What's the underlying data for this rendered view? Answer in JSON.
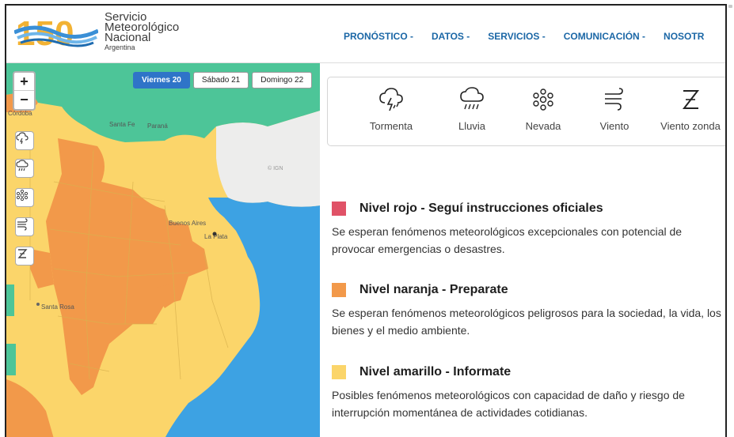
{
  "brand": {
    "logo_number": "150",
    "line1": "Servicio",
    "line2": "Meteorológico",
    "line3": "Nacional",
    "line4": "Argentina"
  },
  "nav": {
    "items": [
      "PRONÓSTICO -",
      "DATOS -",
      "SERVICIOS -",
      "COMUNICACIÓN -",
      "NOSOTR"
    ]
  },
  "map": {
    "zoom_in": "+",
    "zoom_out": "−",
    "days": [
      "Viernes 20",
      "Sábado 21",
      "Domingo 22"
    ],
    "active_day": "Viernes 20",
    "place_labels": [
      "Córdoba",
      "Santa Fe",
      "Paraná",
      "Buenos Aires",
      "La Plata",
      "Santa Rosa"
    ],
    "attribution": "© IGN"
  },
  "phenomena": [
    {
      "label": "Tormenta",
      "icon": "storm-icon"
    },
    {
      "label": "Lluvia",
      "icon": "rain-icon"
    },
    {
      "label": "Nevada",
      "icon": "snow-icon"
    },
    {
      "label": "Viento",
      "icon": "wind-icon"
    },
    {
      "label": "Viento zonda",
      "icon": "zonda-icon"
    }
  ],
  "levels": [
    {
      "title": "Nivel rojo - Seguí instrucciones oficiales",
      "color": "#e05267",
      "description": "Se esperan fenómenos meteorológicos excepcionales con potencial de provocar emergencias o desastres."
    },
    {
      "title": "Nivel naranja - Preparate",
      "color": "#f2994a",
      "description": "Se esperan fenómenos meteorológicos peligrosos para la sociedad, la vida, los bienes y el medio ambiente."
    },
    {
      "title": "Nivel amarillo - Informate",
      "color": "#fbd56a",
      "description": "Posibles fenómenos meteorológicos con capacidad de daño y riesgo de interrupción momentánea de actividades cotidianas."
    }
  ],
  "colors": {
    "nav_text": "#1b67a6",
    "sea": "#3da2e3",
    "green_zone": "#4dc598",
    "yellow_zone": "#fbd56a",
    "orange_zone": "#f2994a",
    "active_day": "#2f74c8"
  }
}
